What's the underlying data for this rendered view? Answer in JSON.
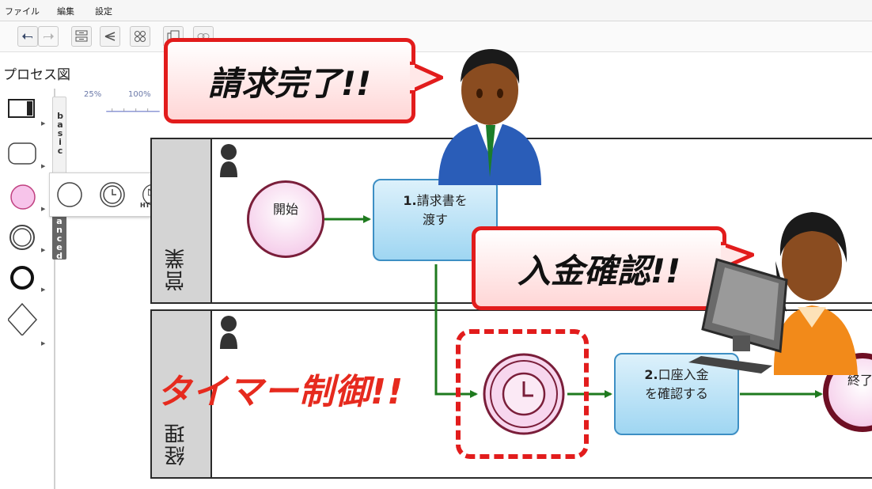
{
  "menu": {
    "file": "ファイル",
    "edit": "編集",
    "settings": "設定"
  },
  "toolbar": {
    "undo_icon": "undo-icon",
    "redo_icon": "redo-icon",
    "layout_icon": "layout-icon",
    "share_icon": "share-icon",
    "group_icon": "group-icon",
    "copy_icon": "copy-icon",
    "link_icon": "link-icon"
  },
  "page": {
    "title": "プロセス図"
  },
  "zoom": {
    "min_label": "25%",
    "max_label": "100%"
  },
  "palette": {
    "tab_basic": "basic",
    "tab_advanced": "anced",
    "items": [
      "task-shape",
      "subprocess-shape",
      "start-event-shape",
      "intermediate-event-shape",
      "end-event-shape",
      "gateway-shape"
    ]
  },
  "event_popup": {
    "items": [
      "plain-event",
      "timer-event",
      "http-message-event"
    ],
    "http_label": "HTTP"
  },
  "lanes": [
    {
      "label": "営業"
    },
    {
      "label": "経理"
    }
  ],
  "nodes": {
    "start_event": "開始",
    "task1_number": "1.",
    "task1_line1": "請求書を",
    "task1_line2": "渡す",
    "task2_number": "2.",
    "task2_line1": "口座入金",
    "task2_line2": "を確認する",
    "end_event": "終了"
  },
  "callouts": {
    "invoice_done": "請求完了!!",
    "payment_check": "入金確認!!",
    "timer_control": "タイマー制御!!"
  },
  "colors": {
    "callout_border": "#e21c1c",
    "callout_text": "#111111",
    "timer_text": "#e62a1e",
    "task_fill": "#9fd6f2",
    "task_border": "#3d8fc4",
    "event_border": "#7a1e3a",
    "flow_arrow": "#1e7a1e",
    "lane_header": "#d4d4d4"
  }
}
